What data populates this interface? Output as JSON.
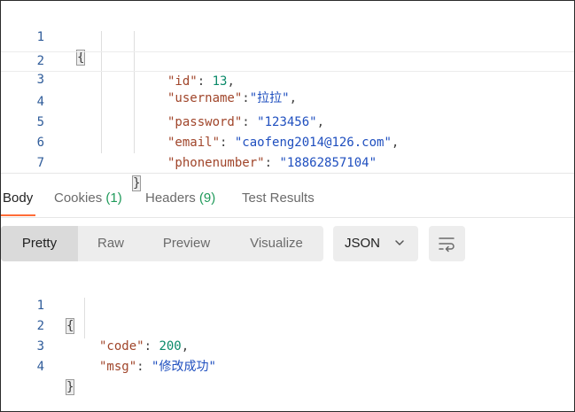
{
  "request_body": {
    "lines": [
      {
        "n": "1",
        "open": "{"
      },
      {
        "n": "2",
        "key": "\"id\"",
        "sep": ": ",
        "val": "13",
        "val_type": "num",
        "tail": ","
      },
      {
        "n": "3",
        "key": "\"username\"",
        "sep": ":",
        "val": "\"拉拉\"",
        "val_type": "str",
        "tail": ","
      },
      {
        "n": "4",
        "key": "\"password\"",
        "sep": ": ",
        "val": "\"123456\"",
        "val_type": "str",
        "tail": ","
      },
      {
        "n": "5",
        "key": "\"email\"",
        "sep": ": ",
        "val": "\"caofeng2014@126.com\"",
        "val_type": "str",
        "tail": ","
      },
      {
        "n": "6",
        "key": "\"phonenumber\"",
        "sep": ": ",
        "val": "\"18862857104\"",
        "val_type": "str",
        "tail": ""
      },
      {
        "n": "7",
        "close": "}"
      }
    ]
  },
  "response_tabs": {
    "body": "Body",
    "cookies": "Cookies",
    "cookies_count": "(1)",
    "headers": "Headers",
    "headers_count": "(9)",
    "test_results": "Test Results",
    "accent_color": "#ff6c37"
  },
  "view_modes": {
    "pretty": "Pretty",
    "raw": "Raw",
    "preview": "Preview",
    "visualize": "Visualize"
  },
  "format_select": {
    "selected": "JSON",
    "icon": "chevron-down-icon"
  },
  "wrap_icon": "wrap-lines-icon",
  "response_body": {
    "lines": [
      {
        "n": "1",
        "open": "{"
      },
      {
        "n": "2",
        "key": "\"code\"",
        "sep": ": ",
        "val": "200",
        "val_type": "num",
        "tail": ","
      },
      {
        "n": "3",
        "key": "\"msg\"",
        "sep": ": ",
        "val": "\"修改成功\"",
        "val_type": "str",
        "tail": ""
      },
      {
        "n": "4",
        "close": "}"
      }
    ]
  }
}
